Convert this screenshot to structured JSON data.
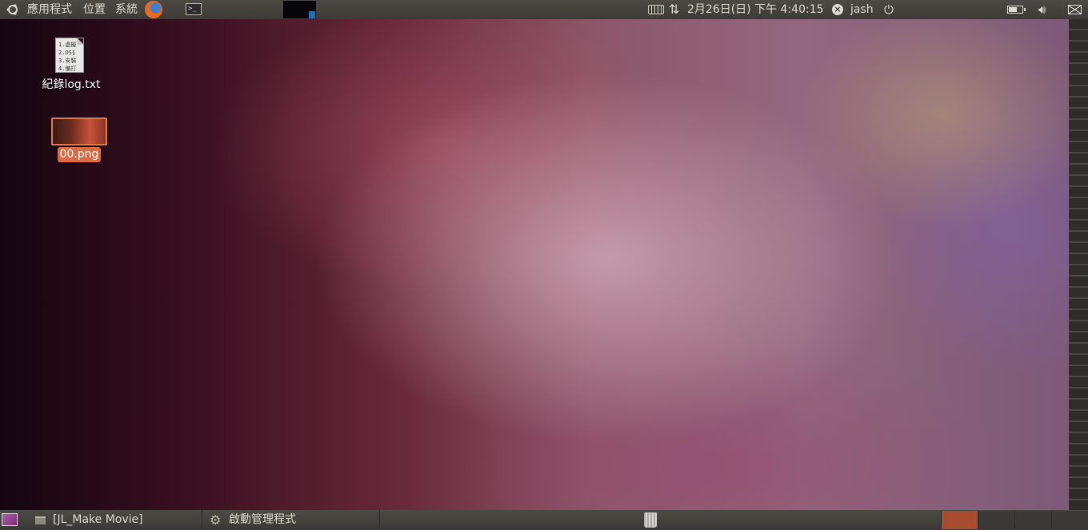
{
  "top_panel": {
    "menus": [
      "應用程式",
      "位置",
      "系統"
    ],
    "clock": "2月26日(日) 下午  4:40:15",
    "username": "jash",
    "terminal_glyph": ">_"
  },
  "desktop": {
    "files": [
      {
        "name": "紀錄log.txt",
        "preview_lines": [
          "1.虛擬",
          "2.OS§",
          "3.安裝",
          "4.備打"
        ]
      },
      {
        "name": "00.png",
        "selected": true
      }
    ]
  },
  "bottom_panel": {
    "tasks": [
      {
        "label": "[JL_Make Movie]"
      },
      {
        "label": "啟動管理程式"
      }
    ],
    "workspaces": [
      {
        "active": true,
        "color": "#a64d2f"
      },
      {
        "active": false
      },
      {
        "active": false
      },
      {
        "active": false
      }
    ]
  },
  "colors": {
    "panel": "#3c3b37",
    "panel_text": "#dfdbd2",
    "selection": "#d86c44"
  }
}
